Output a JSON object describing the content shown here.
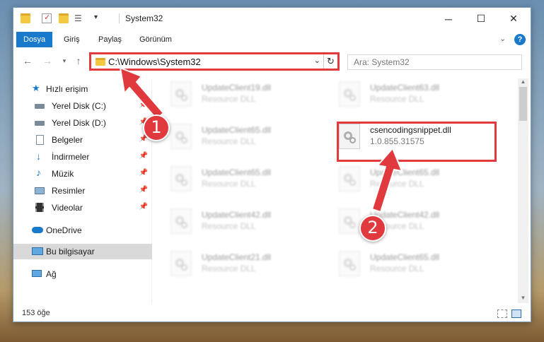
{
  "window": {
    "title": "System32"
  },
  "ribbon": {
    "tabs": [
      "Dosya",
      "Giriş",
      "Paylaş",
      "Görünüm"
    ]
  },
  "address": {
    "path": "C:\\Windows\\System32"
  },
  "search": {
    "placeholder": "Ara: System32"
  },
  "sidebar": {
    "items": [
      {
        "label": "Hızlı erişim",
        "icon": "star-icon",
        "pinned": false
      },
      {
        "label": "Yerel Disk (C:)",
        "icon": "drive-icon",
        "pinned": true
      },
      {
        "label": "Yerel Disk (D:)",
        "icon": "drive-icon",
        "pinned": true
      },
      {
        "label": "Belgeler",
        "icon": "document-icon",
        "pinned": true
      },
      {
        "label": "İndirmeler",
        "icon": "download-icon",
        "pinned": true
      },
      {
        "label": "Müzik",
        "icon": "music-icon",
        "pinned": true
      },
      {
        "label": "Resimler",
        "icon": "picture-icon",
        "pinned": true
      },
      {
        "label": "Videolar",
        "icon": "video-icon",
        "pinned": true
      },
      {
        "label": "OneDrive",
        "icon": "cloud-icon",
        "pinned": false
      },
      {
        "label": "Bu bilgisayar",
        "icon": "computer-icon",
        "pinned": false,
        "selected": true
      },
      {
        "label": "Ağ",
        "icon": "network-icon",
        "pinned": false
      }
    ]
  },
  "files": [
    {
      "name": "UpdateClient19.dll",
      "sub": "Resource DLL"
    },
    {
      "name": "UpdateClient63.dll",
      "sub": "Resource DLL"
    },
    {
      "name": "UpdateClient65.dll",
      "sub": "Resource DLL"
    },
    {
      "name": "csencodingsnippet.dll",
      "sub": "1.0.855.31575",
      "highlighted": true
    },
    {
      "name": "UpdateClient65.dll",
      "sub": "Resource DLL"
    },
    {
      "name": "UpdateClient65.dll",
      "sub": "Resource DLL"
    },
    {
      "name": "UpdateClient42.dll",
      "sub": "Resource DLL"
    },
    {
      "name": "UpdateClient42.dll",
      "sub": "Resource DLL"
    },
    {
      "name": "UpdateClient21.dll",
      "sub": "Resource DLL"
    },
    {
      "name": "UpdateClient65.dll",
      "sub": "Resource DLL"
    }
  ],
  "status": {
    "count_text": "153 öğe"
  },
  "annotations": {
    "step1": "1",
    "step2": "2",
    "color": "#e0393e"
  }
}
